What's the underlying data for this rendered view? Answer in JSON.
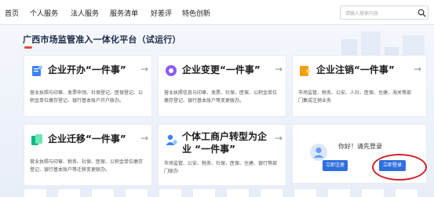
{
  "nav": {
    "items": [
      "首页",
      "个人服务",
      "法人服务",
      "服务清单",
      "好差评",
      "特色创新"
    ],
    "search_placeholder": "请输入搜索内容"
  },
  "platform_title": "广西市场监管准入一体化平台（试运行）",
  "cards": [
    {
      "title": "企业开办“一件事”",
      "desc": "营业执照与印章、发票申领、社保登记、医保登记、公积金单位缴存登记、银行基本账户开户联办。",
      "icon": "business-open-icon",
      "color": "#3b82f6"
    },
    {
      "title": "企业变更“一件事”",
      "desc": "营业执照信息与印章、发票、社保、医保、公积金单位缴存登记、银行基本账户等变更联办。",
      "icon": "business-change-icon",
      "color": "#8b5cf6"
    },
    {
      "title": "企业注销“一件事”",
      "desc": "市场监管、税务、公安、人社、医保、住建、海关等部门集成注销业务",
      "icon": "business-cancel-icon",
      "color": "#f59e0b"
    },
    {
      "title": "企业迁移“一件事”",
      "desc": "营业执照与印章、税务、社保、医保、公积金单位缴存登记、银行基本账户等迁移变更联办。",
      "icon": "business-migrate-icon",
      "color": "#10b981"
    },
    {
      "title_line1": "个体工商户转型为企",
      "title_line2": "业 “一件事”",
      "desc": "市场监管、公安、税务、社保、医保、住建、银行等部门联办",
      "icon": "individual-transform-icon",
      "color": "#3b82f6"
    }
  ],
  "login": {
    "greeting": "你好！请先登录",
    "register_label": "立即注册",
    "login_label": "立即登录"
  },
  "colors": {
    "accent": "#2f6fe0",
    "highlight_ring": "#d0202a"
  }
}
